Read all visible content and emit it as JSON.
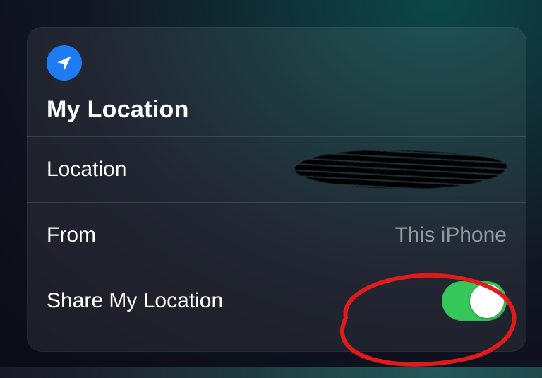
{
  "header": {
    "icon_name": "location-arrow-icon",
    "title": "My Location"
  },
  "rows": {
    "location": {
      "label": "Location",
      "value_redacted": true
    },
    "from": {
      "label": "From",
      "value": "This iPhone"
    },
    "share": {
      "label": "Share My Location",
      "toggle_on": true
    }
  },
  "colors": {
    "accent_blue": "#1e7cf3",
    "toggle_green": "#35c759",
    "annotation_red": "#e11b1b"
  }
}
